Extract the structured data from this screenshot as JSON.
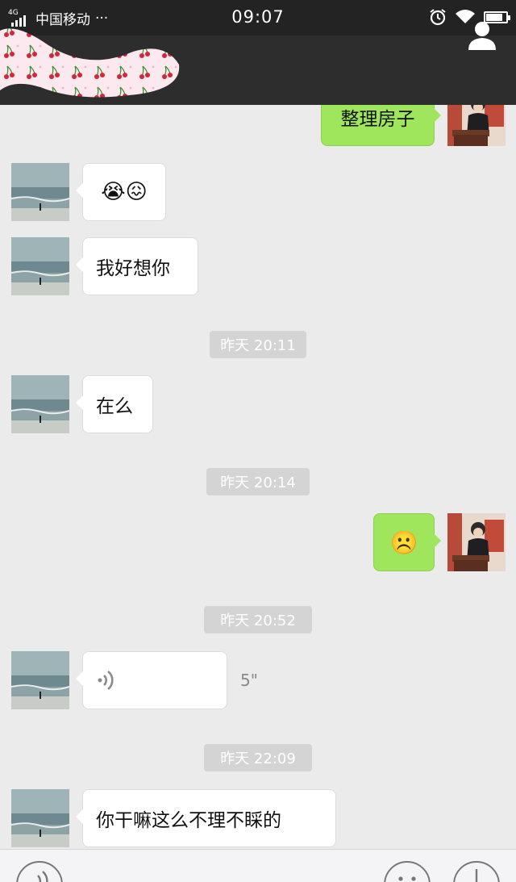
{
  "status_bar": {
    "network_type": "4G",
    "carrier": "中国移动",
    "more_dots": "···",
    "time": "09:07",
    "battery_level": 0.85
  },
  "header": {
    "title_redacted": true,
    "profile_icon": "person-icon"
  },
  "messages": [
    {
      "side": "out",
      "type": "text",
      "text": "整理房子"
    },
    {
      "side": "in",
      "type": "emoji",
      "text": "😭😖"
    },
    {
      "side": "in",
      "type": "text",
      "text": "我好想你"
    },
    {
      "side": "time",
      "text": "昨天 20:11"
    },
    {
      "side": "in",
      "type": "text",
      "text": "在么"
    },
    {
      "side": "time",
      "text": "昨天 20:14"
    },
    {
      "side": "out",
      "type": "emoji",
      "text": "☹️"
    },
    {
      "side": "time",
      "text": "昨天 20:52"
    },
    {
      "side": "in",
      "type": "voice",
      "duration": "5\""
    },
    {
      "side": "time",
      "text": "昨天 22:09"
    },
    {
      "side": "in",
      "type": "text",
      "text": "你干嘛这么不理不睬的"
    }
  ],
  "input_bar": {
    "voice_icon": "voice-icon",
    "emoji_icon": "smiley-icon",
    "plus_icon": "plus-icon"
  },
  "colors": {
    "status_bar_bg": "#232323",
    "nav_bg": "#2d2d2d",
    "chat_bg": "#ebebeb",
    "outgoing_bubble": "#9fe65c",
    "incoming_bubble": "#ffffff",
    "timestamp_bg": "#d4d4d4"
  }
}
